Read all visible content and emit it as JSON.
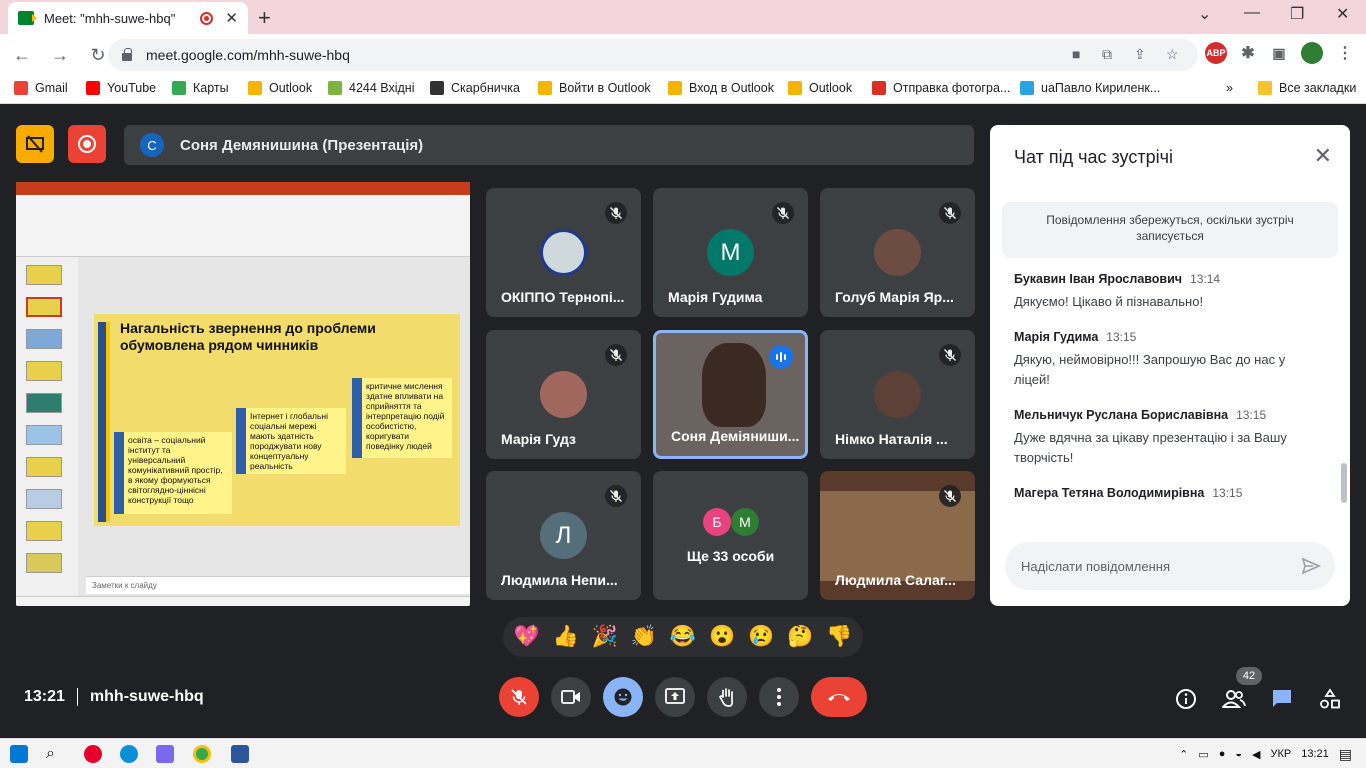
{
  "browser": {
    "tab_title": "Meet: \"mhh-suwe-hbq\"",
    "url": "meet.google.com/mhh-suwe-hbq",
    "bookmarks": [
      {
        "label": "Gmail",
        "color": "#ea4335"
      },
      {
        "label": "YouTube",
        "color": "#ff0000"
      },
      {
        "label": "Карты",
        "color": "#34a853"
      },
      {
        "label": "Outlook",
        "color": "#f4b400"
      },
      {
        "label": "4244 Вхідні",
        "color": "#7cb342"
      },
      {
        "label": "Скарбничка",
        "color": "#333333"
      },
      {
        "label": "Войти в Outlook",
        "color": "#f4b400"
      },
      {
        "label": "Вход в Outlook",
        "color": "#f4b400"
      },
      {
        "label": "Outlook",
        "color": "#f4b400"
      },
      {
        "label": "Отправка фотогра...",
        "color": "#d93025"
      },
      {
        "label": "uaПавло Кириленк...",
        "color": "#2aa3e0"
      }
    ],
    "all_bookmarks": "Все закладки",
    "ext_abp": "ABP"
  },
  "meet": {
    "presenter_initial": "C",
    "presenter_label": "Соня Демянишина (Презентація)",
    "meeting_time": "13:21",
    "meeting_code": "mhh-suwe-hbq",
    "participant_count": "42",
    "reactions": [
      "💖",
      "👍",
      "🎉",
      "👏",
      "😂",
      "😮",
      "😢",
      "🤔",
      "👎"
    ]
  },
  "slide": {
    "title": "Нагальність звернення до проблеми обумовлена рядом чинників",
    "box1": "освіта – соціальний інститут та універсальний комунікативний простір, в якому формуються світоглядно-ціннісні конструкції тощо",
    "box2": "Інтернет і глобальні соціальні мережі мають здатність породжувати нову концептуальну реальність",
    "box3": "критичне мислення здатне впливати на сприйняття та інтерпретацію подій особистістю, коригувати поведінку людей",
    "notes": "Заметки к слайду"
  },
  "tiles": [
    {
      "name": "ОКІППО Тернопі...",
      "type": "logo"
    },
    {
      "name": "Марія Гудима",
      "type": "letter",
      "letter": "M",
      "color": "#00796b"
    },
    {
      "name": "Голуб Марія Яр...",
      "type": "photo",
      "color": "#6d4c41"
    },
    {
      "name": "Марія Гудз",
      "type": "photo",
      "color": "#a1665e"
    },
    {
      "name": "Соня Деміяниши...",
      "type": "video"
    },
    {
      "name": "Німко Наталія ...",
      "type": "photo",
      "color": "#5d4037"
    },
    {
      "name": "Людмила Непи...",
      "type": "letter",
      "letter": "Л",
      "color": "#546e7a"
    },
    {
      "name": "Ще 33 особи",
      "type": "more",
      "letters": [
        "Б",
        "M"
      ]
    },
    {
      "name": "Людмила Салаг...",
      "type": "video2"
    }
  ],
  "chat": {
    "title": "Чат під час зустрічі",
    "notice": "Повідомлення збережуться, оскільки зустріч записується",
    "messages": [
      {
        "sender": "Букавин Іван Ярославович",
        "time": "13:14",
        "text": "Дякуємо! Цікаво й пізнавально!"
      },
      {
        "sender": "Марія Гудима",
        "time": "13:15",
        "text": "Дякую, неймовірно!!! Запрошую Вас до нас у ліцей!"
      },
      {
        "sender": "Мельничук Руслана Бориславівна",
        "time": "13:15",
        "text": "Дуже вдячна за цікаву презентацію і за Вашу творчість!"
      },
      {
        "sender": "Магера Тетяна Володимирівна",
        "time": "13:15",
        "text": ""
      }
    ],
    "input_placeholder": "Надіслати повідомлення"
  },
  "taskbar": {
    "lang": "УКР",
    "clock": "13:21"
  }
}
